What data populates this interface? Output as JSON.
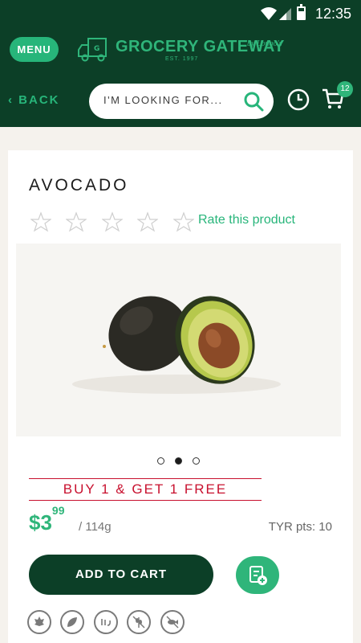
{
  "status_bar": {
    "time": "12:35"
  },
  "header": {
    "menu_label": "MENU",
    "logo_title": "GROCERY GATEWAY",
    "logo_est": "EST. 1997",
    "logo_by": "by Longo's"
  },
  "nav": {
    "back_label": "BACK",
    "search_placeholder": "I'M LOOKING FOR...",
    "cart_count": "12"
  },
  "product": {
    "title": "AVOCADO",
    "rate_label": "Rate this product",
    "rating": {
      "value": 0,
      "max": 5
    },
    "carousel": {
      "count": 3,
      "active_index": 1
    },
    "promo": "BUY 1 & GET 1 FREE",
    "price_dollars": "$3",
    "price_cents": "99",
    "unit": "/ 114g",
    "points": "TYR pts: 10",
    "add_to_cart_label": "ADD TO CART"
  },
  "dietary_icons": [
    "canadian-icon",
    "vegetarian-icon",
    "halal-icon",
    "gluten-free-icon",
    "no-fish-icon"
  ],
  "colors": {
    "header_bg": "#0c3f27",
    "accent": "#27b57a",
    "promo_red": "#c8102e"
  }
}
